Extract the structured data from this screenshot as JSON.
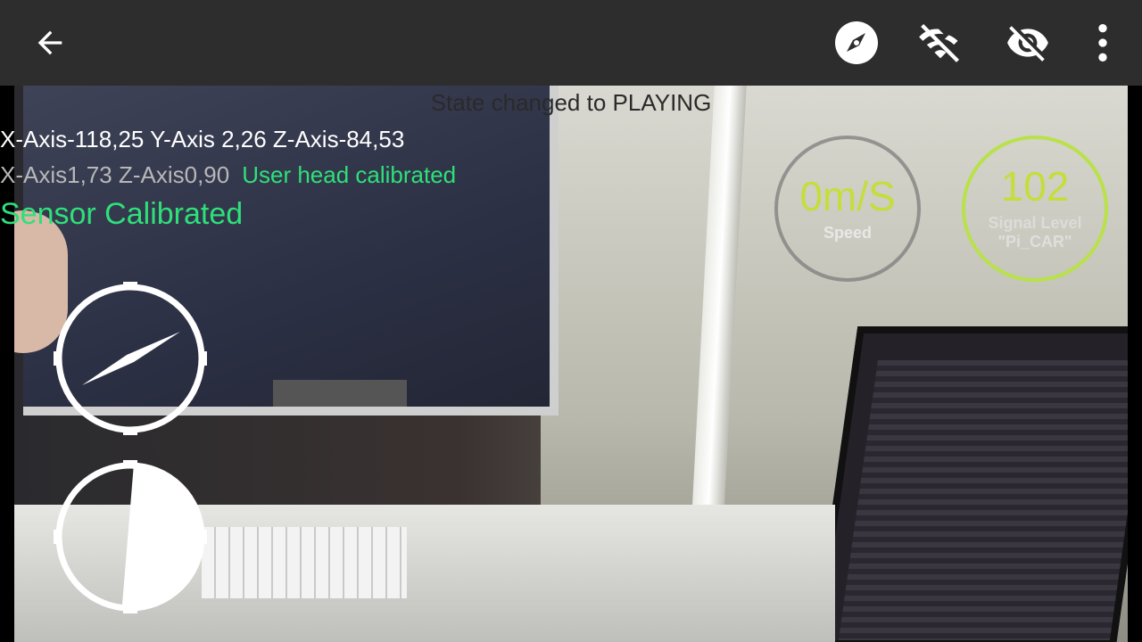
{
  "toolbar": {
    "back_icon": "arrow-back-icon",
    "compass_icon": "compass-icon",
    "wifi_icon": "wifi-off-icon",
    "eye_icon": "eye-off-icon",
    "more_icon": "more-vert-icon"
  },
  "overlay": {
    "state_text": "State changed to PLAYING",
    "axis_line1": "X-Axis-118,25 Y-Axis 2,26 Z-Axis-84,53",
    "axis_line2": "X-Axis1,73 Z-Axis0,90",
    "user_calibrated": "User head calibrated",
    "sensor_calibrated": "Sensor Calibrated"
  },
  "speed_gauge": {
    "value": "0m/S",
    "label": "Speed"
  },
  "signal_gauge": {
    "value": "102",
    "label": "Signal Level",
    "network": "\"Pi_CAR\""
  },
  "colors": {
    "toolbar_bg": "#2d2d2d",
    "accent_green": "#2ee07a",
    "gauge_value": "#c4de3b",
    "signal_ring": "#b9e14a"
  }
}
